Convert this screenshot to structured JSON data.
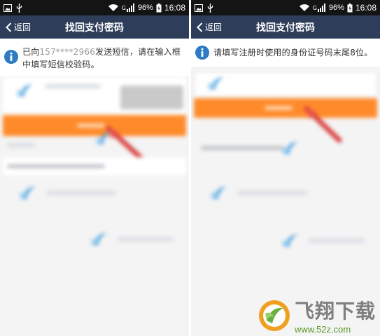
{
  "status": {
    "battery_pct": "96%",
    "time": "16:08",
    "network": "G"
  },
  "nav": {
    "back_label": "返回",
    "title": "找回支付密码"
  },
  "screens": [
    {
      "notice_prefix": "已向",
      "notice_masked": "157****2966",
      "notice_suffix": "发送短信，请在输入框中填写短信校验码。"
    },
    {
      "notice_text": "请填写注册时使用的身份证号码末尾8位。"
    }
  ],
  "watermark": {
    "title": "飞翔下载",
    "url": "www.52z.com"
  },
  "colors": {
    "status_bar": "#141414",
    "nav_bar": "#2e3e5a",
    "accent": "#ff8a2a",
    "info_icon": "#2e7bc4"
  }
}
